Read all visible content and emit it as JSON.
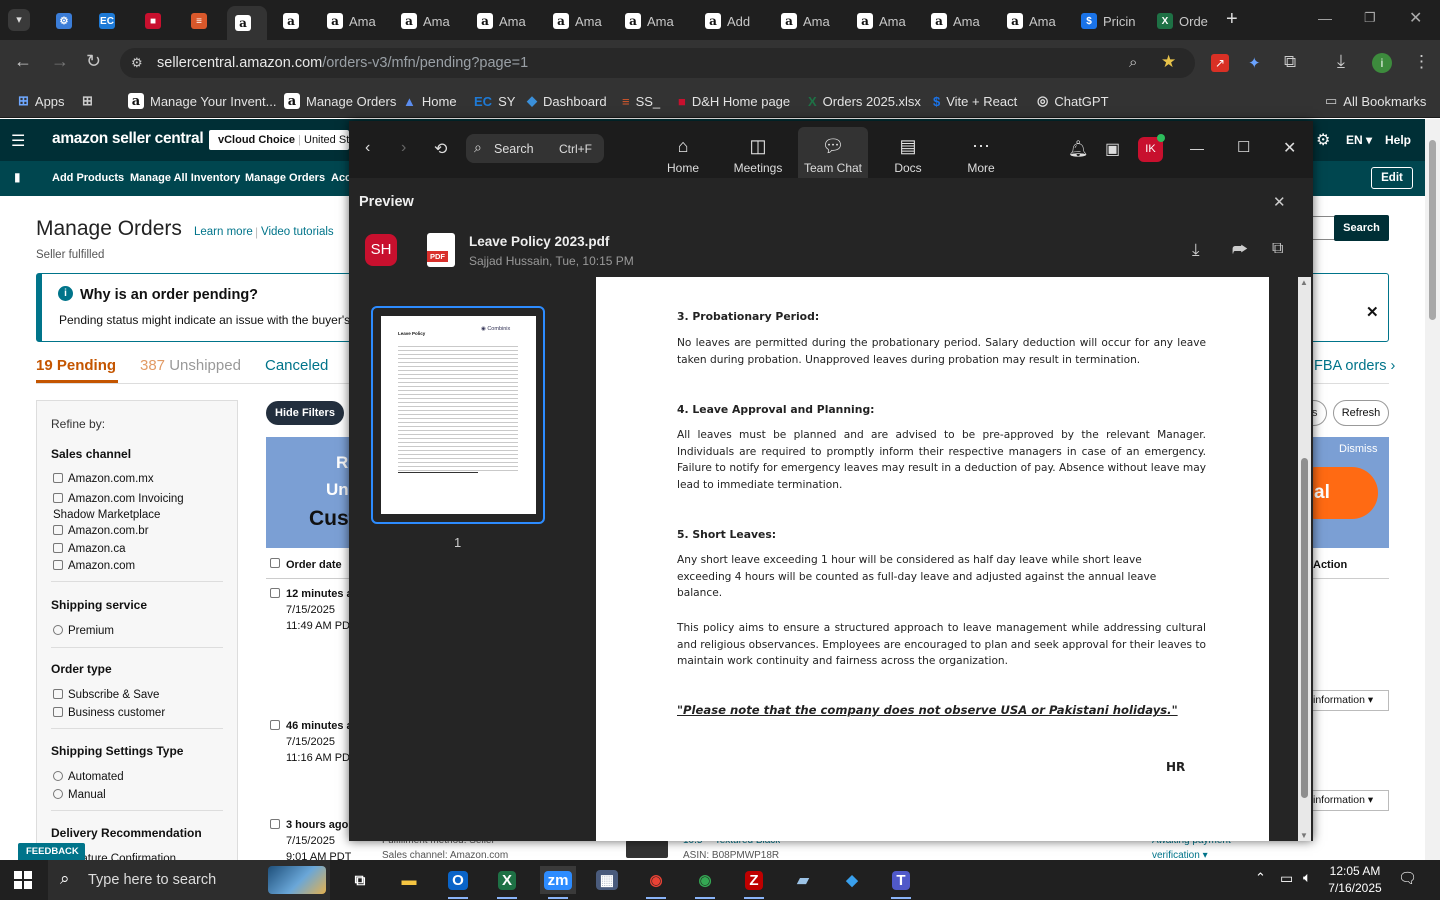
{
  "browser": {
    "tabs": [
      {
        "label": "",
        "icon": "gear-icon"
      },
      {
        "label": "",
        "icon": "ec-icon"
      },
      {
        "label": "",
        "icon": "dh-icon"
      },
      {
        "label": "",
        "icon": "layers-icon"
      },
      {
        "label": "",
        "icon": "amazon-icon",
        "active": true
      },
      {
        "label": "",
        "icon": "amazon-icon"
      },
      {
        "label": "Ama",
        "icon": "amazon-icon"
      },
      {
        "label": "Ama",
        "icon": "amazon-icon"
      },
      {
        "label": "Ama",
        "icon": "amazon-icon"
      },
      {
        "label": "Ama",
        "icon": "amazon-icon"
      },
      {
        "label": "Ama",
        "icon": "amazon-icon"
      },
      {
        "label": "Add",
        "icon": "amazon-icon"
      },
      {
        "label": "Ama",
        "icon": "amazon-icon"
      },
      {
        "label": "Ama",
        "icon": "amazon-icon"
      },
      {
        "label": "Ama",
        "icon": "amazon-icon"
      },
      {
        "label": "Ama",
        "icon": "amazon-icon"
      },
      {
        "label": "Pricin",
        "icon": "dollar-icon"
      },
      {
        "label": "Orde",
        "icon": "excel-icon"
      }
    ],
    "url_host": "sellercentral.amazon.com",
    "url_path": "/orders-v3/mfn/pending?page=1",
    "profile_initial": "i",
    "bookmarks": [
      {
        "label": "Apps"
      },
      {
        "label": "Manage Your Invent..."
      },
      {
        "label": "Manage Orders"
      },
      {
        "label": "Home"
      },
      {
        "label": "SY"
      },
      {
        "label": "Dashboard"
      },
      {
        "label": "SS_"
      },
      {
        "label": "D&H Home page"
      },
      {
        "label": "Orders 2025.xlsx"
      },
      {
        "label": "Vite + React"
      },
      {
        "label": "ChatGPT"
      }
    ],
    "all_bookmarks": "All Bookmarks"
  },
  "seller_central": {
    "logo": "amazon seller central",
    "account_button": "vCloud Choice",
    "marketplace": "United Sta",
    "lang": "EN",
    "help": "Help",
    "nav": [
      "Add Products",
      "Manage All Inventory",
      "Manage Orders",
      "Acc"
    ],
    "edit": "Edit",
    "page_title": "Manage Orders",
    "learn_more": "Learn more",
    "video_tutorials": "Video tutorials",
    "subtitle": "Seller fulfilled",
    "search_btn": "Search",
    "info_title": "Why is an order pending?",
    "info_text": "Pending status might indicate an issue with the buyer's pa",
    "tabs": {
      "pending_count": "19",
      "pending": "Pending",
      "unshipped_count": "387",
      "unshipped": "Unshipped",
      "canceled": "Canceled",
      "fba": "FBA orders"
    },
    "hide_filters": "Hide Filters",
    "refresh": "Refresh",
    "dismiss": "Dismiss",
    "promo_text_1": "R",
    "promo_text_2": "Un",
    "promo_text_3": "Cust",
    "promo_btn": "al",
    "col_order_date": "Order date",
    "col_action": "Action",
    "refine_by": "Refine by:",
    "filters": {
      "sales_channel": "Sales channel",
      "sales_channel_items": [
        "Amazon.com.mx",
        "Amazon.com Invoicing Shadow Marketplace",
        "Amazon.com.br",
        "Amazon.ca",
        "Amazon.com"
      ],
      "shipping_service": "Shipping service",
      "shipping_service_items": [
        "Premium"
      ],
      "order_type": "Order type",
      "order_type_items": [
        "Subscribe & Save",
        "Business customer"
      ],
      "shipping_settings": "Shipping Settings Type",
      "shipping_settings_items": [
        "Automated",
        "Manual"
      ],
      "delivery_rec": "Delivery Recommendation",
      "delivery_rec_cut": "nature Confirmation"
    },
    "orders": [
      {
        "ago": "12 minutes ag",
        "date": "7/15/2025",
        "time": "11:49 AM PDT"
      },
      {
        "ago": "46 minutes ag",
        "date": "7/15/2025",
        "time": "11:16 AM PDT"
      },
      {
        "ago": "3 hours ago",
        "date": "7/15/2025",
        "time": "9:01 AM PDT"
      }
    ],
    "info_link": "information",
    "feedback": "FEEDBACK",
    "bottom_peek": {
      "fulfillment": "Fulfillment method: Seller",
      "channel": "Sales channel: Amazon.com",
      "product": "10.5\" - Textured Black",
      "asin": "ASIN: B08PMWP18R",
      "awaiting": "Awaiting payment",
      "verification": "verification"
    }
  },
  "zoom": {
    "search": "Search",
    "shortcut": "Ctrl+F",
    "nav": [
      {
        "label": "Home",
        "icon": "home-icon"
      },
      {
        "label": "Meetings",
        "icon": "camera-icon"
      },
      {
        "label": "Team Chat",
        "icon": "chat-icon",
        "active": true
      },
      {
        "label": "Docs",
        "icon": "doc-icon"
      },
      {
        "label": "More",
        "icon": "more-icon"
      }
    ],
    "avatar": "IK",
    "preview_title": "Preview",
    "sender_initials": "SH",
    "file_name": "Leave Policy 2023.pdf",
    "file_meta": "Sajjad Hussain, Tue, 10:15 PM",
    "page_number": "1",
    "pdf": {
      "h3": "3. Probationary Period:",
      "p3": "No leaves are permitted during the probationary period. Salary deduction will occur for any leave taken during probation. Unapproved leaves during probation may result in termination.",
      "h4": "4. Leave Approval and Planning:",
      "p4": "All leaves must be planned and are advised to be pre-approved by the relevant Manager. Individuals are required to promptly inform their respective managers in case of an emergency. Failure to notify for emergency leaves may result in a deduction of pay. Absence without leave may lead to immediate termination.",
      "h5": "5. Short Leaves:",
      "p5": "Any short leave exceeding 1 hour will be considered as half day leave while short leave exceeding 4 hours will be counted as full-day leave and adjusted against the annual leave balance.",
      "p6": "This policy aims to ensure a structured approach to leave management while addressing cultural and religious observances. Employees are encouraged to plan and seek approval for their leaves to maintain work continuity and fairness across the organization.",
      "note": "\"Please note that the company does not observe USA or Pakistani holidays.\"",
      "signoff": "HR"
    },
    "thumb_title": "Leave Policy",
    "thumb_logo": "Combinix"
  },
  "taskbar": {
    "search_placeholder": "Type here to search",
    "time": "12:05 AM",
    "date": "7/16/2025"
  }
}
